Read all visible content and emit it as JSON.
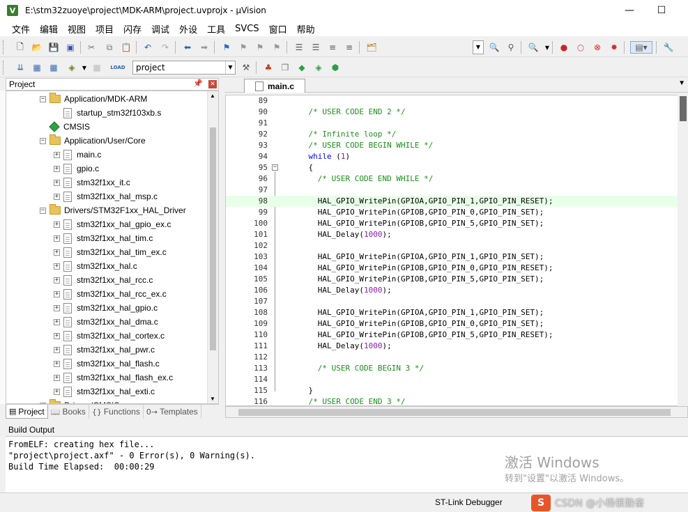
{
  "window": {
    "app_icon_letter": "V",
    "title": "E:\\stm32zuoye\\project\\MDK-ARM\\project.uvprojx - µVision",
    "minimize": "—",
    "maximize": "☐"
  },
  "menu": [
    "文件",
    "编辑",
    "视图",
    "项目",
    "闪存",
    "调试",
    "外设",
    "工具",
    "SVCS",
    "窗口",
    "帮助"
  ],
  "toolbar2": {
    "target_select": "project"
  },
  "project_panel": {
    "title": "Project",
    "pin": "📌",
    "close": "✕",
    "tree": [
      {
        "type": "folder",
        "label": "Application/MDK-ARM",
        "expander": "−",
        "indent": 1
      },
      {
        "type": "file",
        "label": "startup_stm32f103xb.s",
        "expander": "",
        "indent": 2
      },
      {
        "type": "cmsis",
        "label": "CMSIS",
        "expander": "",
        "indent": 1
      },
      {
        "type": "folder",
        "label": "Application/User/Core",
        "expander": "−",
        "indent": 1
      },
      {
        "type": "file",
        "label": "main.c",
        "expander": "+",
        "indent": 2
      },
      {
        "type": "file",
        "label": "gpio.c",
        "expander": "+",
        "indent": 2
      },
      {
        "type": "file",
        "label": "stm32f1xx_it.c",
        "expander": "+",
        "indent": 2
      },
      {
        "type": "file",
        "label": "stm32f1xx_hal_msp.c",
        "expander": "+",
        "indent": 2
      },
      {
        "type": "folder",
        "label": "Drivers/STM32F1xx_HAL_Driver",
        "expander": "−",
        "indent": 1
      },
      {
        "type": "file",
        "label": "stm32f1xx_hal_gpio_ex.c",
        "expander": "+",
        "indent": 2
      },
      {
        "type": "file",
        "label": "stm32f1xx_hal_tim.c",
        "expander": "+",
        "indent": 2
      },
      {
        "type": "file",
        "label": "stm32f1xx_hal_tim_ex.c",
        "expander": "+",
        "indent": 2
      },
      {
        "type": "file",
        "label": "stm32f1xx_hal.c",
        "expander": "+",
        "indent": 2
      },
      {
        "type": "file",
        "label": "stm32f1xx_hal_rcc.c",
        "expander": "+",
        "indent": 2
      },
      {
        "type": "file",
        "label": "stm32f1xx_hal_rcc_ex.c",
        "expander": "+",
        "indent": 2
      },
      {
        "type": "file",
        "label": "stm32f1xx_hal_gpio.c",
        "expander": "+",
        "indent": 2
      },
      {
        "type": "file",
        "label": "stm32f1xx_hal_dma.c",
        "expander": "+",
        "indent": 2
      },
      {
        "type": "file",
        "label": "stm32f1xx_hal_cortex.c",
        "expander": "+",
        "indent": 2
      },
      {
        "type": "file",
        "label": "stm32f1xx_hal_pwr.c",
        "expander": "+",
        "indent": 2
      },
      {
        "type": "file",
        "label": "stm32f1xx_hal_flash.c",
        "expander": "+",
        "indent": 2
      },
      {
        "type": "file",
        "label": "stm32f1xx_hal_flash_ex.c",
        "expander": "+",
        "indent": 2
      },
      {
        "type": "file",
        "label": "stm32f1xx_hal_exti.c",
        "expander": "+",
        "indent": 2
      },
      {
        "type": "folder",
        "label": "Drivers/CMSIS",
        "expander": "−",
        "indent": 1
      }
    ],
    "tabs": [
      {
        "icon": "▤",
        "label": "Project",
        "active": true
      },
      {
        "icon": "📖",
        "label": "Books",
        "active": false
      },
      {
        "icon": "{}",
        "label": "Functions",
        "active": false
      },
      {
        "icon": "0→",
        "label": "Templates",
        "active": false
      }
    ]
  },
  "editor": {
    "tab_label": "main.c",
    "highlight_line": 98,
    "lines": [
      {
        "n": "89",
        "code": [],
        "fold": ""
      },
      {
        "n": "90",
        "code": [
          [
            "    ",
            ""
          ],
          [
            "/* USER CODE END 2 */",
            "cm"
          ]
        ],
        "fold": ""
      },
      {
        "n": "91",
        "code": [],
        "fold": ""
      },
      {
        "n": "92",
        "code": [
          [
            "    ",
            ""
          ],
          [
            "/* Infinite loop */",
            "cm"
          ]
        ],
        "fold": ""
      },
      {
        "n": "93",
        "code": [
          [
            "    ",
            ""
          ],
          [
            "/* USER CODE BEGIN WHILE */",
            "cm"
          ]
        ],
        "fold": ""
      },
      {
        "n": "94",
        "code": [
          [
            "    ",
            ""
          ],
          [
            "while",
            "kw"
          ],
          [
            " (",
            ""
          ],
          [
            "1",
            "num"
          ],
          [
            ")",
            ""
          ]
        ],
        "fold": ""
      },
      {
        "n": "95",
        "code": [
          [
            "    {",
            ""
          ]
        ],
        "fold": "−"
      },
      {
        "n": "96",
        "code": [
          [
            "      ",
            ""
          ],
          [
            "/* USER CODE END WHILE */",
            "cm"
          ]
        ],
        "fold": ""
      },
      {
        "n": "97",
        "code": [],
        "fold": ""
      },
      {
        "n": "98",
        "code": [
          [
            "      ",
            ""
          ],
          [
            "HAL_GPIO_WritePin(GPIOA,GPIO_PIN_1,GPIO_PIN_RESET);",
            "fn"
          ]
        ],
        "fold": ""
      },
      {
        "n": "99",
        "code": [
          [
            "      ",
            ""
          ],
          [
            "HAL_GPIO_WritePin(GPIOB,GPIO_PIN_0,GPIO_PIN_SET);",
            "fn"
          ]
        ],
        "fold": ""
      },
      {
        "n": "100",
        "code": [
          [
            "      ",
            ""
          ],
          [
            "HAL_GPIO_WritePin(GPIOB,GPIO_PIN_5,GPIO_PIN_SET);",
            "fn"
          ]
        ],
        "fold": ""
      },
      {
        "n": "101",
        "code": [
          [
            "      HAL_Delay(",
            ""
          ],
          [
            "1000",
            "num"
          ],
          [
            ");",
            ""
          ]
        ],
        "fold": ""
      },
      {
        "n": "102",
        "code": [],
        "fold": ""
      },
      {
        "n": "103",
        "code": [
          [
            "      ",
            ""
          ],
          [
            "HAL_GPIO_WritePin(GPIOA,GPIO_PIN_1,GPIO_PIN_SET);",
            "fn"
          ]
        ],
        "fold": ""
      },
      {
        "n": "104",
        "code": [
          [
            "      ",
            ""
          ],
          [
            "HAL_GPIO_WritePin(GPIOB,GPIO_PIN_0,GPIO_PIN_RESET);",
            "fn"
          ]
        ],
        "fold": ""
      },
      {
        "n": "105",
        "code": [
          [
            "      ",
            ""
          ],
          [
            "HAL_GPIO_WritePin(GPIOB,GPIO_PIN_5,GPIO_PIN_SET);",
            "fn"
          ]
        ],
        "fold": ""
      },
      {
        "n": "106",
        "code": [
          [
            "      HAL_Delay(",
            ""
          ],
          [
            "1000",
            "num"
          ],
          [
            ");",
            ""
          ]
        ],
        "fold": ""
      },
      {
        "n": "107",
        "code": [],
        "fold": ""
      },
      {
        "n": "108",
        "code": [
          [
            "      ",
            ""
          ],
          [
            "HAL_GPIO_WritePin(GPIOA,GPIO_PIN_1,GPIO_PIN_SET);",
            "fn"
          ]
        ],
        "fold": ""
      },
      {
        "n": "109",
        "code": [
          [
            "      ",
            ""
          ],
          [
            "HAL_GPIO_WritePin(GPIOB,GPIO_PIN_0,GPIO_PIN_SET);",
            "fn"
          ]
        ],
        "fold": ""
      },
      {
        "n": "110",
        "code": [
          [
            "      ",
            ""
          ],
          [
            "HAL_GPIO_WritePin(GPIOB,GPIO_PIN_5,GPIO_PIN_RESET);",
            "fn"
          ]
        ],
        "fold": ""
      },
      {
        "n": "111",
        "code": [
          [
            "      HAL_Delay(",
            ""
          ],
          [
            "1000",
            "num"
          ],
          [
            ");",
            ""
          ]
        ],
        "fold": ""
      },
      {
        "n": "112",
        "code": [],
        "fold": ""
      },
      {
        "n": "113",
        "code": [
          [
            "      ",
            ""
          ],
          [
            "/* USER CODE BEGIN 3 */",
            "cm"
          ]
        ],
        "fold": ""
      },
      {
        "n": "114",
        "code": [],
        "fold": ""
      },
      {
        "n": "115",
        "code": [
          [
            "    }",
            ""
          ]
        ],
        "fold": ""
      },
      {
        "n": "116",
        "code": [
          [
            "    ",
            ""
          ],
          [
            "/* USER CODE END 3 */",
            "cm"
          ]
        ],
        "fold": ""
      }
    ]
  },
  "build_output": {
    "title": "Build Output",
    "lines": [
      "FromELF: creating hex file...",
      "\"project\\project.axf\" - 0 Error(s), 0 Warning(s).",
      "Build Time Elapsed:  00:00:29"
    ]
  },
  "watermark": {
    "line1": "激活 Windows",
    "line2": "转到\"设置\"以激活 Windows。"
  },
  "status": {
    "debugger": "ST-Link Debugger",
    "csdn_logo": "S",
    "csdn_text": "CSDN @小杨很勤奋"
  }
}
